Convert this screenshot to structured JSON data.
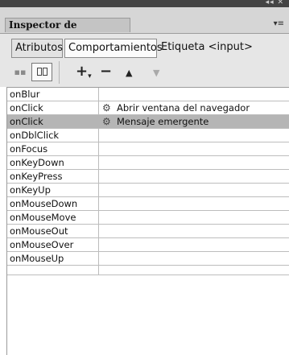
{
  "window": {
    "controls": "◂◂ ✕"
  },
  "panel": {
    "title": "Inspector de etiquetas",
    "menu_icon": "options-menu-icon"
  },
  "subtabs": [
    {
      "label": "Atributos"
    },
    {
      "label": "Comportamientos"
    },
    {
      "label": "Etiqueta <input>"
    }
  ],
  "toolbar": {
    "add_label": "+",
    "add_caret": "▾",
    "remove_label": "−",
    "up_label": "▲",
    "down_label": "▼"
  },
  "events": [
    {
      "event": "onBlur",
      "action": ""
    },
    {
      "event": "onClick",
      "action": "Abrir ventana del navegador"
    },
    {
      "event": "onClick",
      "action": "Mensaje emergente",
      "selected": true
    },
    {
      "event": "onDblClick",
      "action": ""
    },
    {
      "event": "onFocus",
      "action": ""
    },
    {
      "event": "onKeyDown",
      "action": ""
    },
    {
      "event": "onKeyPress",
      "action": ""
    },
    {
      "event": "onKeyUp",
      "action": ""
    },
    {
      "event": "onMouseDown",
      "action": ""
    },
    {
      "event": "onMouseMove",
      "action": ""
    },
    {
      "event": "onMouseOut",
      "action": ""
    },
    {
      "event": "onMouseOver",
      "action": ""
    },
    {
      "event": "onMouseUp",
      "action": ""
    },
    {
      "event": "",
      "action": ""
    }
  ]
}
